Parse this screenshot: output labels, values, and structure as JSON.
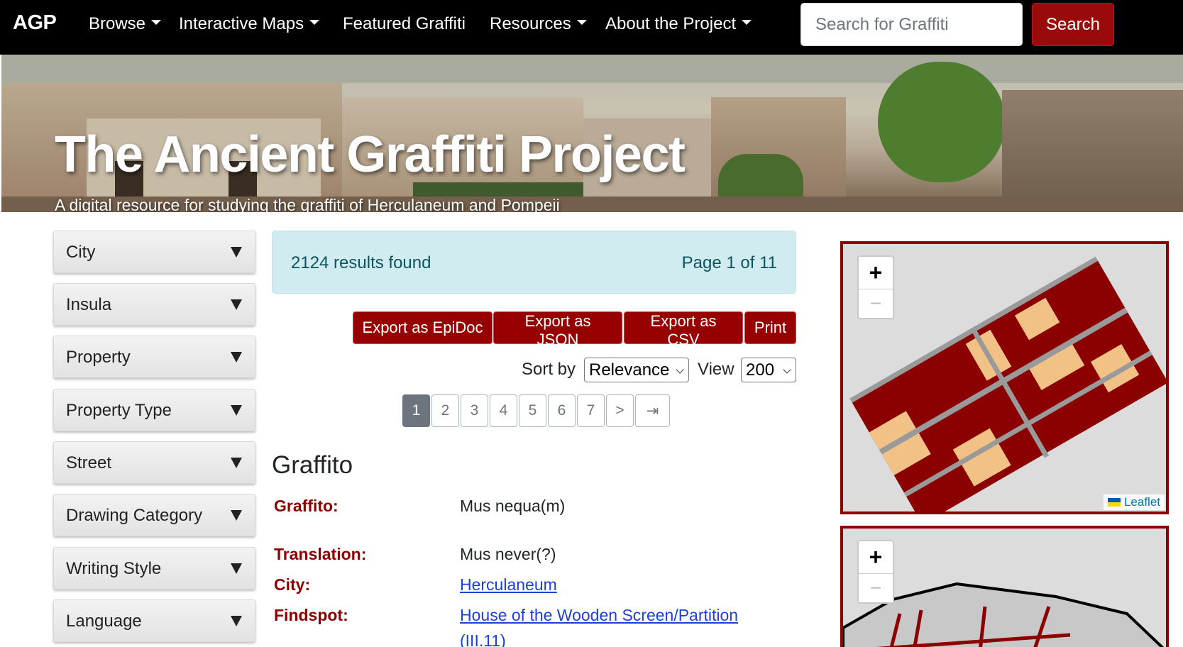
{
  "navbar": {
    "brand": "AGP",
    "items": [
      {
        "label": "Browse",
        "dropdown": true
      },
      {
        "label": "Interactive Maps",
        "dropdown": true
      },
      {
        "label": "Featured Graffiti",
        "dropdown": false
      },
      {
        "label": "Resources",
        "dropdown": true
      },
      {
        "label": "About the Project",
        "dropdown": true
      }
    ],
    "search_placeholder": "Search for Graffiti",
    "search_button": "Search"
  },
  "hero": {
    "title": "The Ancient Graffiti Project",
    "subtitle": "A digital resource for studying the graffiti of Herculaneum and Pompeii"
  },
  "filters": [
    "City",
    "Insula",
    "Property",
    "Property Type",
    "Street",
    "Drawing Category",
    "Writing Style",
    "Language"
  ],
  "results": {
    "count_text": "2124 results found",
    "page_text": "Page 1 of 11",
    "export_buttons": [
      "Export as EpiDoc",
      "Export as JSON",
      "Export as CSV",
      "Print"
    ],
    "sort_label": "Sort by",
    "sort_value": "Relevance",
    "view_label": "View",
    "view_value": "200",
    "pages": [
      "1",
      "2",
      "3",
      "4",
      "5",
      "6",
      "7",
      ">",
      "⇥"
    ],
    "active_page": "1"
  },
  "graffito": {
    "section_title": "Graffito",
    "graffito_label": "Graffito:",
    "graffito_value": "Mus nequa(m)",
    "translation_label": "Translation:",
    "translation_value": "Mus never(?)",
    "city_label": "City:",
    "city_value": "Herculaneum",
    "findspot_label": "Findspot:",
    "findspot_value_line1": "House of the Wooden Screen/Partition",
    "findspot_value_line2": "(III.11)"
  },
  "maps": {
    "zoom_in": "+",
    "zoom_out": "−",
    "attribution": "Leaflet"
  },
  "colors": {
    "navbar_bg": "#000000",
    "brand_red": "#960000",
    "map_dark": "#8b0000",
    "map_light": "#f2c185",
    "alert_bg": "#d1ecf1",
    "link": "#1a42d6"
  }
}
